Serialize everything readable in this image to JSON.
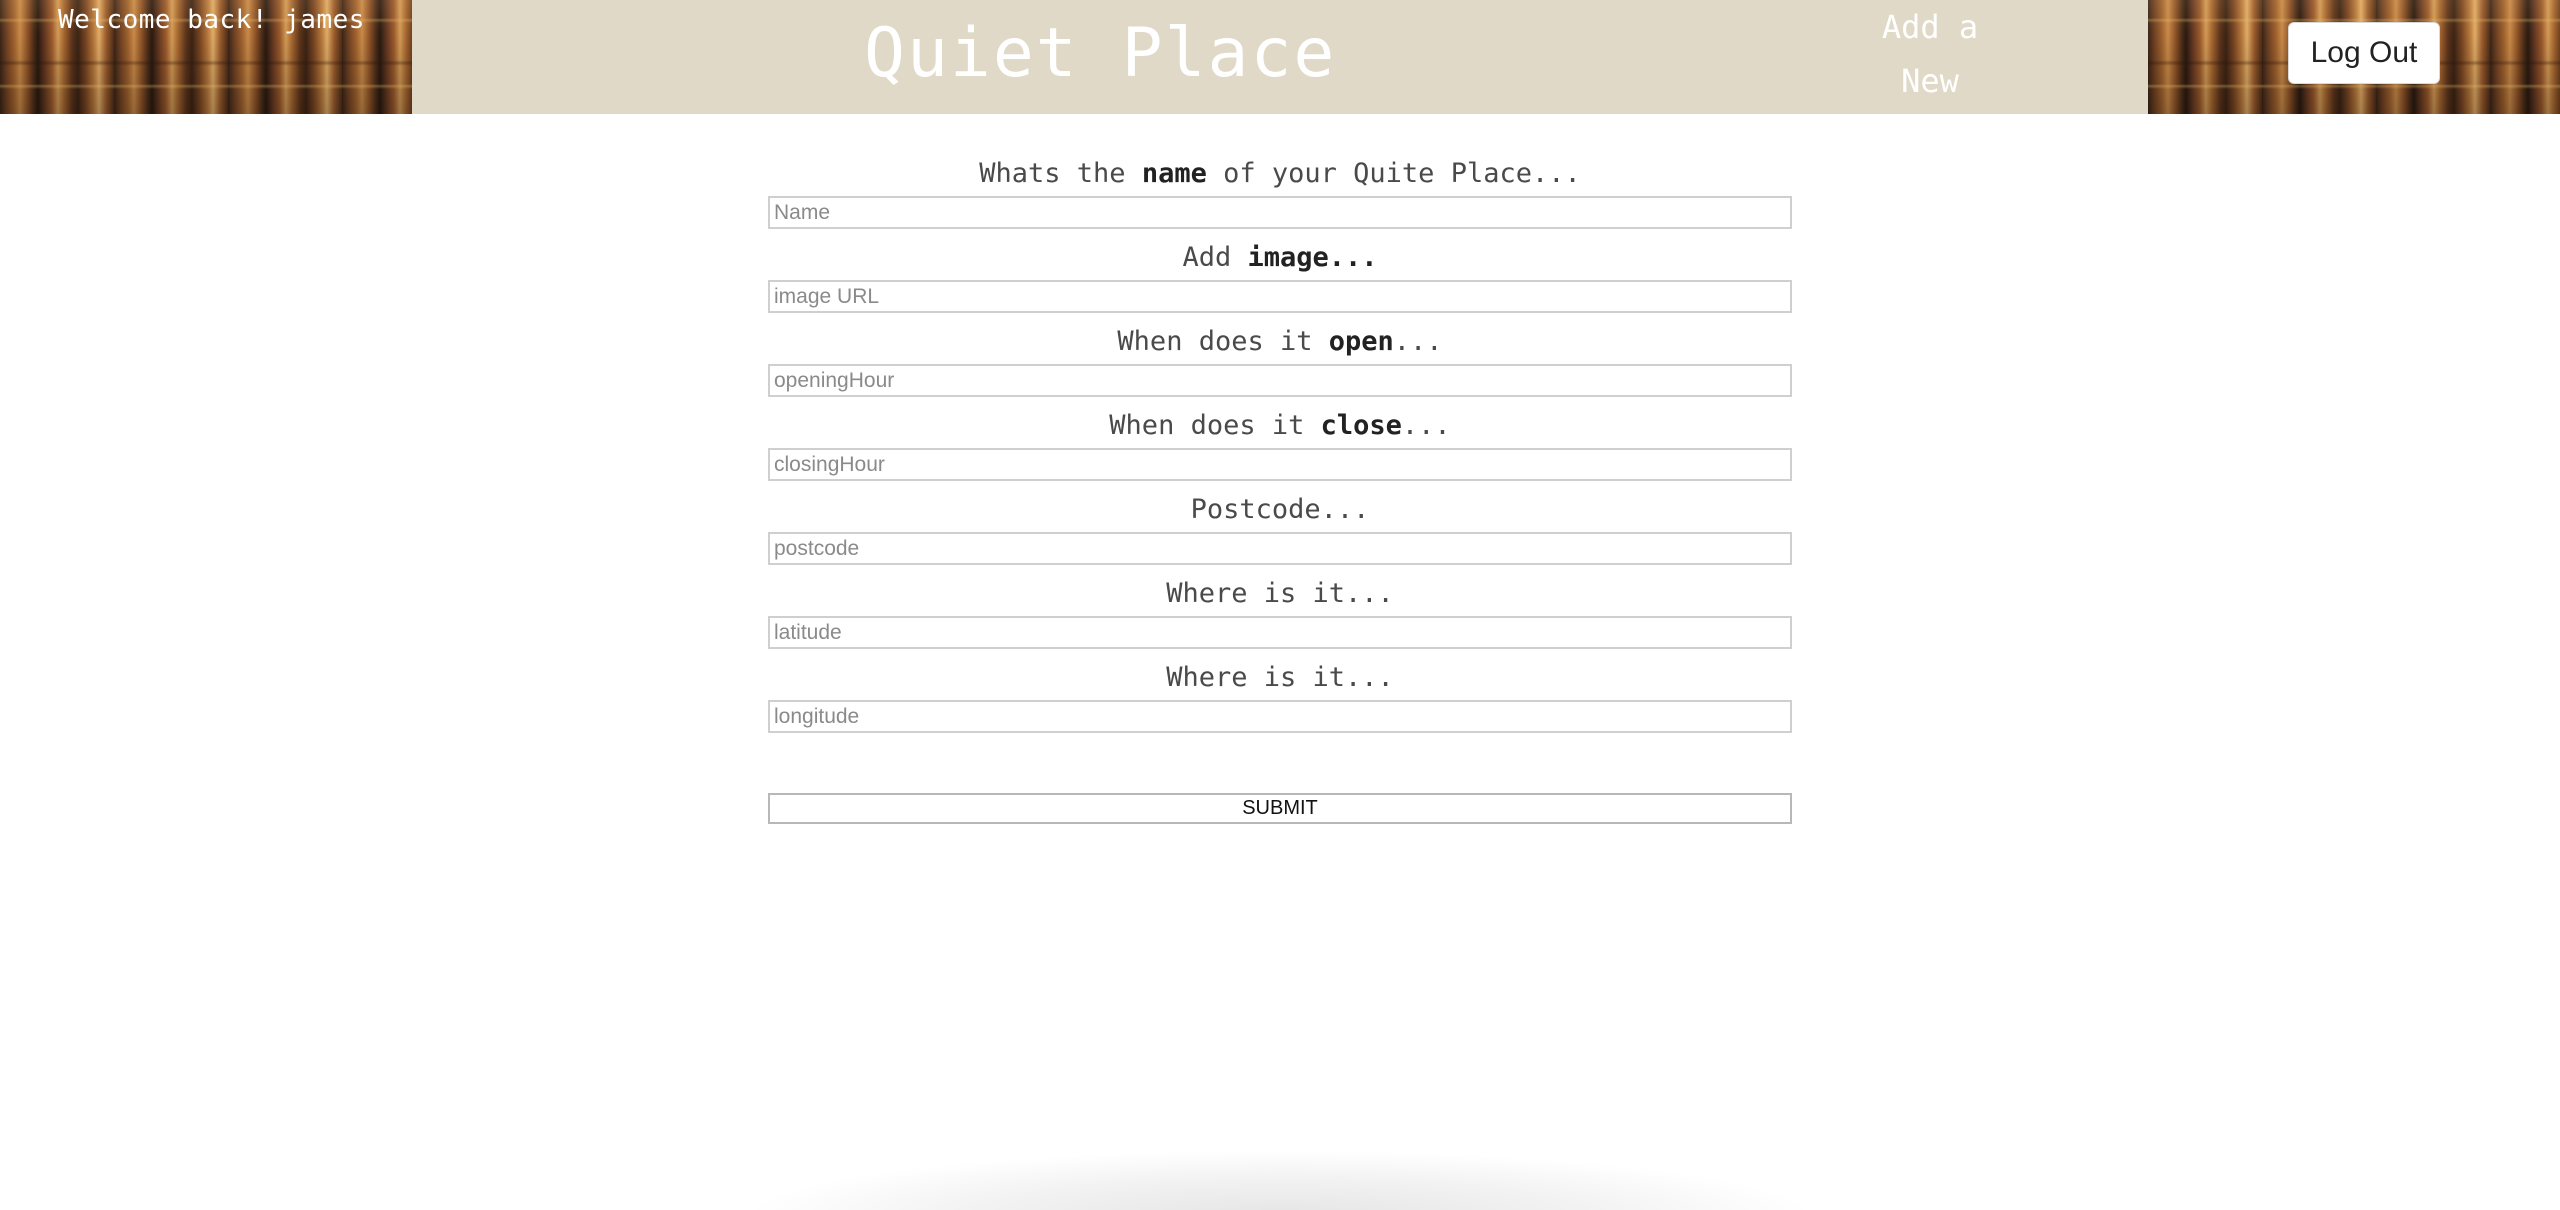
{
  "header": {
    "welcome_text": "Welcome back! james",
    "title": "Quiet Place",
    "add_new_line1": "Add a",
    "add_new_line2": "New",
    "logout_label": "Log Out",
    "colors": {
      "header_band": "#e0d9c7",
      "header_text": "#ffffff"
    }
  },
  "form": {
    "fields": [
      {
        "label_before": "Whats the ",
        "label_bold": "name",
        "label_after": " of your Quite Place...",
        "placeholder": "Name"
      },
      {
        "label_before": "Add ",
        "label_bold": "image...",
        "label_after": "",
        "placeholder": "image URL"
      },
      {
        "label_before": "When does it ",
        "label_bold": "open",
        "label_after": "...",
        "placeholder": "openingHour"
      },
      {
        "label_before": "When does it ",
        "label_bold": "close",
        "label_after": "...",
        "placeholder": "closingHour"
      },
      {
        "label_before": "Postcode...",
        "label_bold": "",
        "label_after": "",
        "placeholder": "postcode"
      },
      {
        "label_before": "Where is it...",
        "label_bold": "",
        "label_after": "",
        "placeholder": "latitude"
      },
      {
        "label_before": "Where is it...",
        "label_bold": "",
        "label_after": "",
        "placeholder": "longitude"
      }
    ],
    "submit_label": "SUBMIT"
  }
}
